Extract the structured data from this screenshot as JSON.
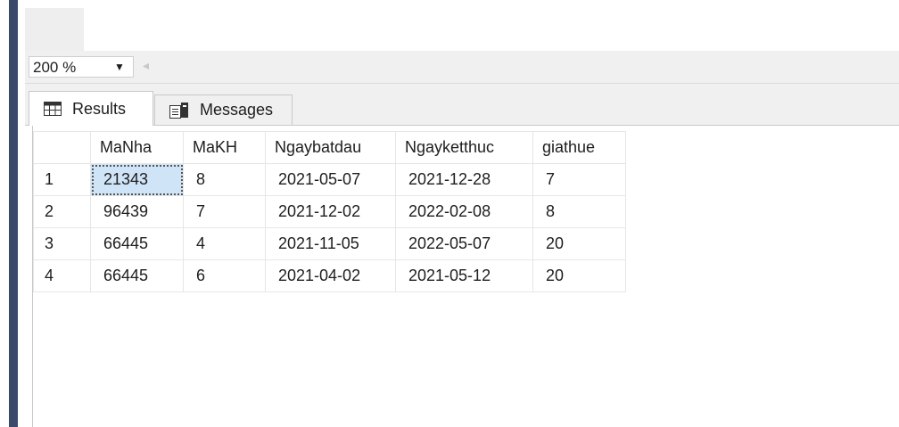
{
  "zoom": {
    "value": "200 %"
  },
  "tabs": [
    {
      "label": "Results"
    },
    {
      "label": "Messages"
    }
  ],
  "grid": {
    "columns": [
      "",
      "MaNha",
      "MaKH",
      "Ngaybatdau",
      "Ngayketthuc",
      "giathue"
    ],
    "rows": [
      [
        "1",
        "21343",
        "8",
        "2021-05-07",
        "2021-12-28",
        "7"
      ],
      [
        "2",
        "96439",
        "7",
        "2021-12-02",
        "2022-02-08",
        "8"
      ],
      [
        "3",
        "66445",
        "4",
        "2021-11-05",
        "2022-05-07",
        "20"
      ],
      [
        "4",
        "66445",
        "6",
        "2021-04-02",
        "2021-05-12",
        "20"
      ]
    ],
    "selected_cell": "21343"
  },
  "colors": {
    "selection": "#cfe4f7",
    "side_bar": "#3b4a6b"
  }
}
